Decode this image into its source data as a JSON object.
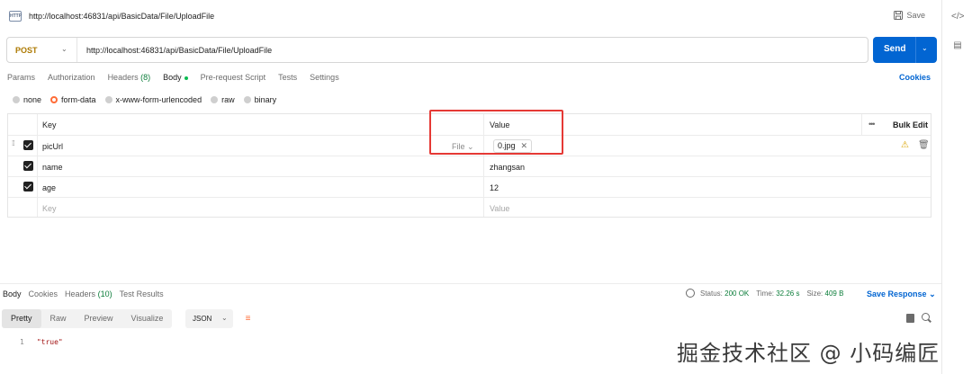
{
  "header": {
    "icon_text": "HTTP",
    "title": "http://localhost:46831/api/BasicData/File/UploadFile",
    "save_label": "Save"
  },
  "request": {
    "method": "POST",
    "url": "http://localhost:46831/api/BasicData/File/UploadFile",
    "send_label": "Send"
  },
  "tabs": {
    "params": "Params",
    "authorization": "Authorization",
    "headers": "Headers",
    "headers_count": "(8)",
    "body": "Body",
    "prerequest": "Pre-request Script",
    "tests": "Tests",
    "settings": "Settings",
    "cookies": "Cookies"
  },
  "body_types": {
    "none": "none",
    "form_data": "form-data",
    "urlencoded": "x-www-form-urlencoded",
    "raw": "raw",
    "binary": "binary",
    "selected": "form-data"
  },
  "table": {
    "key_header": "Key",
    "value_header": "Value",
    "more": "•••",
    "bulk_edit": "Bulk Edit",
    "rows": [
      {
        "key": "picUrl",
        "type": "File",
        "value": "0.jpg",
        "checked": true
      },
      {
        "key": "name",
        "value": "zhangsan",
        "checked": true
      },
      {
        "key": "age",
        "value": "12",
        "checked": true
      }
    ],
    "key_placeholder": "Key",
    "value_placeholder": "Value"
  },
  "response": {
    "tabs": {
      "body": "Body",
      "cookies": "Cookies",
      "headers": "Headers",
      "headers_count": "(10)",
      "test_results": "Test Results"
    },
    "status_label": "Status:",
    "status_value": "200 OK",
    "time_label": "Time:",
    "time_value": "32.26 s",
    "size_label": "Size:",
    "size_value": "409 B",
    "save_response": "Save Response",
    "views": {
      "pretty": "Pretty",
      "raw": "Raw",
      "preview": "Preview",
      "visualize": "Visualize"
    },
    "format": "JSON",
    "line_number": "1",
    "line_content": "\"true\""
  },
  "watermark": "掘金技术社区 @ 小码编匠",
  "colors": {
    "send": "#0265d2",
    "method": "#ad7a03",
    "accent": "#ff6c37",
    "highlight": "#e53935"
  }
}
